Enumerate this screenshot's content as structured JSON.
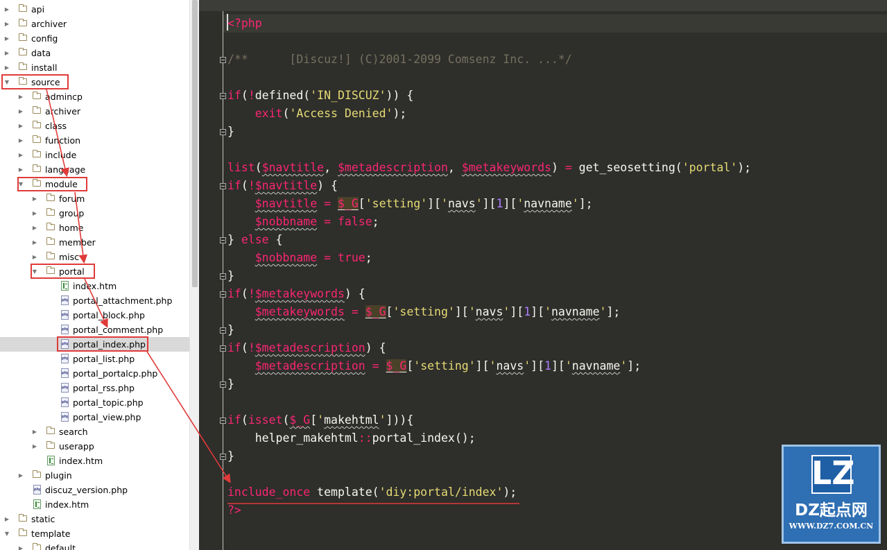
{
  "colors": {
    "editor_bg": "#2e2e2b",
    "keyword": "#f92672",
    "string": "#e6db74",
    "number": "#ae81ff",
    "comment": "#75715e",
    "annotation": "#e03a3a",
    "logo_bg": "#2f6fb3"
  },
  "tree": {
    "items": [
      {
        "label": "api",
        "kind": "folder",
        "expanded": false
      },
      {
        "label": "archiver",
        "kind": "folder",
        "expanded": false
      },
      {
        "label": "config",
        "kind": "folder",
        "expanded": false
      },
      {
        "label": "data",
        "kind": "folder",
        "expanded": false
      },
      {
        "label": "install",
        "kind": "folder",
        "expanded": false
      },
      {
        "label": "source",
        "kind": "folder",
        "expanded": true
      },
      {
        "label": "admincp",
        "kind": "folder",
        "expanded": false
      },
      {
        "label": "archiver",
        "kind": "folder",
        "expanded": false
      },
      {
        "label": "class",
        "kind": "folder",
        "expanded": false
      },
      {
        "label": "function",
        "kind": "folder",
        "expanded": false
      },
      {
        "label": "include",
        "kind": "folder",
        "expanded": false
      },
      {
        "label": "language",
        "kind": "folder",
        "expanded": false
      },
      {
        "label": "module",
        "kind": "folder",
        "expanded": true
      },
      {
        "label": "forum",
        "kind": "folder",
        "expanded": false
      },
      {
        "label": "group",
        "kind": "folder",
        "expanded": false
      },
      {
        "label": "home",
        "kind": "folder",
        "expanded": false
      },
      {
        "label": "member",
        "kind": "folder",
        "expanded": false
      },
      {
        "label": "misc",
        "kind": "folder",
        "expanded": false
      },
      {
        "label": "portal",
        "kind": "folder",
        "expanded": true
      },
      {
        "label": "index.htm",
        "kind": "htm"
      },
      {
        "label": "portal_attachment.php",
        "kind": "php"
      },
      {
        "label": "portal_block.php",
        "kind": "php"
      },
      {
        "label": "portal_comment.php",
        "kind": "php"
      },
      {
        "label": "portal_index.php",
        "kind": "php",
        "selected": true
      },
      {
        "label": "portal_list.php",
        "kind": "php"
      },
      {
        "label": "portal_portalcp.php",
        "kind": "php"
      },
      {
        "label": "portal_rss.php",
        "kind": "php"
      },
      {
        "label": "portal_topic.php",
        "kind": "php"
      },
      {
        "label": "portal_view.php",
        "kind": "php"
      },
      {
        "label": "search",
        "kind": "folder",
        "expanded": false
      },
      {
        "label": "userapp",
        "kind": "folder",
        "expanded": false
      },
      {
        "label": "index.htm",
        "kind": "htm"
      },
      {
        "label": "plugin",
        "kind": "folder",
        "expanded": false
      },
      {
        "label": "discuz_version.php",
        "kind": "php"
      },
      {
        "label": "index.htm",
        "kind": "htm"
      },
      {
        "label": "static",
        "kind": "folder",
        "expanded": false
      },
      {
        "label": "template",
        "kind": "folder",
        "expanded": true
      },
      {
        "label": "default",
        "kind": "folder",
        "expanded": false
      }
    ],
    "icon_text": "php"
  },
  "editor": {
    "lines": [
      [
        {
          "t": "<?php",
          "c": "kw"
        }
      ],
      [],
      [
        {
          "t": "/**",
          "c": "cmt"
        },
        {
          "t": "      [Discuz!] (C)2001-2099 Comsenz Inc. ...",
          "c": "cmt"
        },
        {
          "t": "*/",
          "c": "cmt"
        }
      ],
      [],
      [
        {
          "t": "if",
          "c": "kw"
        },
        {
          "t": "(",
          "c": "plain"
        },
        {
          "t": "!",
          "c": "op"
        },
        {
          "t": "defined(",
          "c": "plain"
        },
        {
          "t": "'",
          "c": "str"
        },
        {
          "t": "IN_DISCUZ",
          "c": "str"
        },
        {
          "t": "'",
          "c": "str"
        },
        {
          "t": ")) {",
          "c": "plain"
        }
      ],
      [
        {
          "t": "    ",
          "c": "plain"
        },
        {
          "t": "exit",
          "c": "kw"
        },
        {
          "t": "(",
          "c": "plain"
        },
        {
          "t": "'Access Denied'",
          "c": "str"
        },
        {
          "t": ");",
          "c": "plain"
        }
      ],
      [
        {
          "t": "}",
          "c": "plain"
        }
      ],
      [],
      [
        {
          "t": "list",
          "c": "kw"
        },
        {
          "t": "(",
          "c": "plain"
        },
        {
          "t": "$navtitle",
          "c": "vr"
        },
        {
          "t": ", ",
          "c": "plain"
        },
        {
          "t": "$metadescription",
          "c": "vr"
        },
        {
          "t": ", ",
          "c": "plain"
        },
        {
          "t": "$metakeywords",
          "c": "vr"
        },
        {
          "t": ") ",
          "c": "plain"
        },
        {
          "t": "=",
          "c": "op"
        },
        {
          "t": " get_seosetting(",
          "c": "plain"
        },
        {
          "t": "'portal'",
          "c": "str"
        },
        {
          "t": ");",
          "c": "plain"
        }
      ],
      [
        {
          "t": "if",
          "c": "kw"
        },
        {
          "t": "(",
          "c": "plain"
        },
        {
          "t": "!",
          "c": "op"
        },
        {
          "t": "$navtitle",
          "c": "vr"
        },
        {
          "t": ") {",
          "c": "plain"
        }
      ],
      [
        {
          "t": "    ",
          "c": "plain"
        },
        {
          "t": "$navtitle",
          "c": "vr"
        },
        {
          "t": " = ",
          "c": "op"
        },
        {
          "t": "$_G",
          "c": "bgv"
        },
        {
          "t": "[",
          "c": "plain"
        },
        {
          "t": "'setting'",
          "c": "str"
        },
        {
          "t": "][",
          "c": "plain"
        },
        {
          "t": "'",
          "c": "str"
        },
        {
          "t": "navs",
          "c": "sq"
        },
        {
          "t": "'",
          "c": "str"
        },
        {
          "t": "][",
          "c": "plain"
        },
        {
          "t": "1",
          "c": "num"
        },
        {
          "t": "][",
          "c": "plain"
        },
        {
          "t": "'",
          "c": "str"
        },
        {
          "t": "navname",
          "c": "sq"
        },
        {
          "t": "'",
          "c": "str"
        },
        {
          "t": "];",
          "c": "plain"
        }
      ],
      [
        {
          "t": "    ",
          "c": "plain"
        },
        {
          "t": "$nobbname",
          "c": "vr"
        },
        {
          "t": " = ",
          "c": "op"
        },
        {
          "t": "false",
          "c": "kw"
        },
        {
          "t": ";",
          "c": "plain"
        }
      ],
      [
        {
          "t": "} ",
          "c": "plain"
        },
        {
          "t": "else",
          "c": "kw"
        },
        {
          "t": " {",
          "c": "plain"
        }
      ],
      [
        {
          "t": "    ",
          "c": "plain"
        },
        {
          "t": "$nobbname",
          "c": "vr"
        },
        {
          "t": " = ",
          "c": "op"
        },
        {
          "t": "true",
          "c": "kw"
        },
        {
          "t": ";",
          "c": "plain"
        }
      ],
      [
        {
          "t": "}",
          "c": "plain"
        }
      ],
      [
        {
          "t": "if",
          "c": "kw"
        },
        {
          "t": "(",
          "c": "plain"
        },
        {
          "t": "!",
          "c": "op"
        },
        {
          "t": "$metakeywords",
          "c": "vr"
        },
        {
          "t": ") {",
          "c": "plain"
        }
      ],
      [
        {
          "t": "    ",
          "c": "plain"
        },
        {
          "t": "$metakeywords",
          "c": "vr"
        },
        {
          "t": " = ",
          "c": "op"
        },
        {
          "t": "$_G",
          "c": "bgv"
        },
        {
          "t": "[",
          "c": "plain"
        },
        {
          "t": "'setting'",
          "c": "str"
        },
        {
          "t": "][",
          "c": "plain"
        },
        {
          "t": "'",
          "c": "str"
        },
        {
          "t": "navs",
          "c": "sq"
        },
        {
          "t": "'",
          "c": "str"
        },
        {
          "t": "][",
          "c": "plain"
        },
        {
          "t": "1",
          "c": "num"
        },
        {
          "t": "][",
          "c": "plain"
        },
        {
          "t": "'",
          "c": "str"
        },
        {
          "t": "navname",
          "c": "sq"
        },
        {
          "t": "'",
          "c": "str"
        },
        {
          "t": "];",
          "c": "plain"
        }
      ],
      [
        {
          "t": "}",
          "c": "plain"
        }
      ],
      [
        {
          "t": "if",
          "c": "kw"
        },
        {
          "t": "(",
          "c": "plain"
        },
        {
          "t": "!",
          "c": "op"
        },
        {
          "t": "$metadescription",
          "c": "vr"
        },
        {
          "t": ") {",
          "c": "plain"
        }
      ],
      [
        {
          "t": "    ",
          "c": "plain"
        },
        {
          "t": "$metadescription",
          "c": "vr"
        },
        {
          "t": " = ",
          "c": "op"
        },
        {
          "t": "$_G",
          "c": "bgv"
        },
        {
          "t": "[",
          "c": "plain"
        },
        {
          "t": "'setting'",
          "c": "str"
        },
        {
          "t": "][",
          "c": "plain"
        },
        {
          "t": "'",
          "c": "str"
        },
        {
          "t": "navs",
          "c": "sq"
        },
        {
          "t": "'",
          "c": "str"
        },
        {
          "t": "][",
          "c": "plain"
        },
        {
          "t": "1",
          "c": "num"
        },
        {
          "t": "][",
          "c": "plain"
        },
        {
          "t": "'",
          "c": "str"
        },
        {
          "t": "navname",
          "c": "sq"
        },
        {
          "t": "'",
          "c": "str"
        },
        {
          "t": "];",
          "c": "plain"
        }
      ],
      [
        {
          "t": "}",
          "c": "plain"
        }
      ],
      [],
      [
        {
          "t": "if",
          "c": "kw"
        },
        {
          "t": "(",
          "c": "plain"
        },
        {
          "t": "isset",
          "c": "kw"
        },
        {
          "t": "(",
          "c": "plain"
        },
        {
          "t": "$_G",
          "c": "vr"
        },
        {
          "t": "[",
          "c": "plain"
        },
        {
          "t": "'",
          "c": "str"
        },
        {
          "t": "makehtml",
          "c": "sq"
        },
        {
          "t": "'",
          "c": "str"
        },
        {
          "t": "])){",
          "c": "plain"
        }
      ],
      [
        {
          "t": "    helper_makehtml",
          "c": "plain"
        },
        {
          "t": "::",
          "c": "op"
        },
        {
          "t": "portal_index();",
          "c": "plain"
        }
      ],
      [
        {
          "t": "}",
          "c": "plain"
        }
      ],
      [],
      [
        {
          "t": "include_once",
          "c": "kw"
        },
        {
          "t": " template(",
          "c": "plain"
        },
        {
          "t": "'diy:portal/index'",
          "c": "str"
        },
        {
          "t": ");",
          "c": "plain"
        }
      ],
      [
        {
          "t": "?>",
          "c": "kw"
        }
      ]
    ]
  },
  "logo": {
    "letters": "LZ",
    "name": "DZ起点网",
    "url": "WWW.DZ7.COM.CN"
  }
}
